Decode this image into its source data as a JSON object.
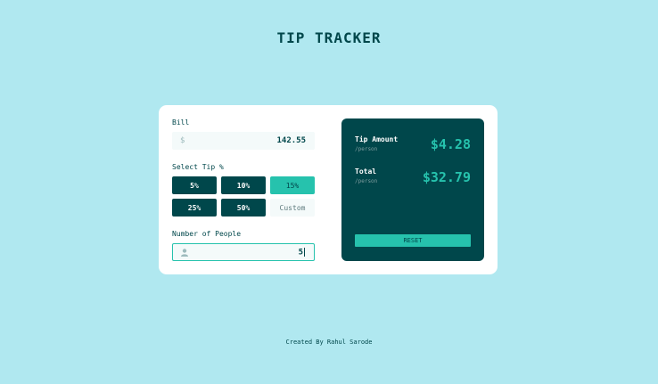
{
  "app": {
    "title": "TIP TRACKER"
  },
  "bill": {
    "label": "Bill",
    "currency_symbol": "$",
    "value": "142.55"
  },
  "tip": {
    "label": "Select Tip %",
    "options": [
      "5%",
      "10%",
      "15%",
      "25%",
      "50%"
    ],
    "selected": "15%",
    "custom_placeholder": "Custom"
  },
  "people": {
    "label": "Number of People",
    "value": "5"
  },
  "results": {
    "tip_amount_label": "Tip Amount",
    "tip_amount_sub": "/person",
    "tip_amount_value": "$4.28",
    "total_label": "Total",
    "total_sub": "/person",
    "total_value": "$32.79",
    "reset_label": "RESET"
  },
  "footer": {
    "credit": "Created By Rahul Sarode"
  },
  "colors": {
    "background": "#b0e8f0",
    "dark_green": "#00474b",
    "accent": "#26c2ad",
    "input_bg": "#f4fafa"
  },
  "icons": {
    "people_field": "person-icon"
  }
}
